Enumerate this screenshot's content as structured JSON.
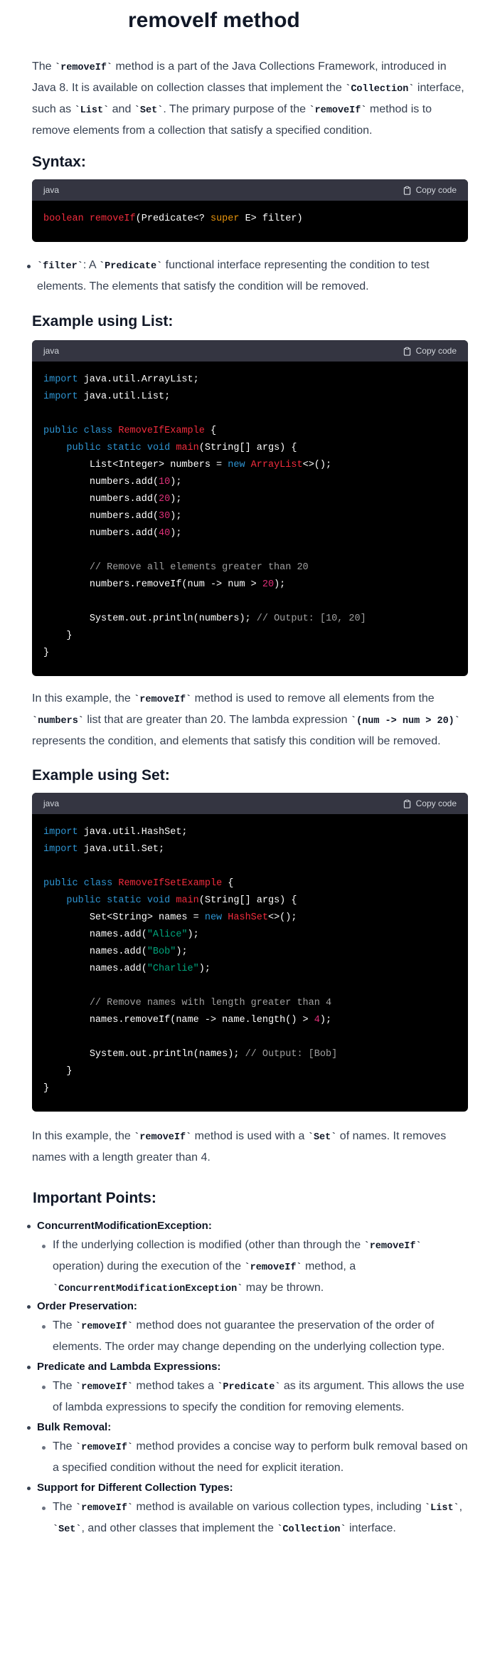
{
  "title": "removeIf method",
  "intro": {
    "t1": "The ",
    "c1": "`removeIf`",
    "t2": " method is a part of the Java Collections Framework, introduced in Java 8. It is available on collection classes that implement the ",
    "c2": "`Collection`",
    "t3": " interface, such as ",
    "c3": "`List`",
    "t4": " and ",
    "c4": "`Set`",
    "t5": ". The primary purpose of the ",
    "c5": "`removeIf`",
    "t6": " method is to remove elements from a collection that satisfy a specified condition."
  },
  "syntax_heading": "Syntax:",
  "code_lang": "java",
  "copy_label": "Copy code",
  "syntax_code": {
    "kw": "boolean",
    "fn": "removeIf",
    "a": "(Predicate<? ",
    "sup": "super",
    "b": " E> filter)"
  },
  "filter_item": {
    "c1": "`filter`",
    "t1": ": A ",
    "c2": "`Predicate`",
    "t2": " functional interface representing the condition to test elements. The elements that satisfy the condition will be removed."
  },
  "list_heading": "Example using List:",
  "list_code": {
    "l1a": "import",
    "l1b": " java.util.ArrayList;",
    "l2a": "import",
    "l2b": " java.util.List;",
    "l3a": "public",
    "l3b": "class",
    "l3c": "RemoveIfExample",
    "l3d": " {",
    "l4a": "public",
    "l4b": "static",
    "l4c": "void",
    "l4d": "main",
    "l4e": "(String[] args) {",
    "l5a": "List<Integer> numbers = ",
    "l5b": "new",
    "l5c": "ArrayList",
    "l5d": "<>();",
    "l6a": "numbers.add(",
    "l6b": "10",
    "l6c": ");",
    "l7a": "numbers.add(",
    "l7b": "20",
    "l7c": ");",
    "l8a": "numbers.add(",
    "l8b": "30",
    "l8c": ");",
    "l9a": "numbers.add(",
    "l9b": "40",
    "l9c": ");",
    "l10": "// Remove all elements greater than 20",
    "l11a": "numbers.removeIf(num -> num > ",
    "l11b": "20",
    "l11c": ");",
    "l12a": "System.out.println(numbers); ",
    "l12b": "// Output: [10, 20]",
    "l13": "}",
    "l14": "}"
  },
  "list_para": {
    "t1": "In this example, the ",
    "c1": "`removeIf`",
    "t2": " method is used to remove all elements from the ",
    "c2": "`numbers`",
    "t3": " list that are greater than 20. The lambda expression ",
    "c3": "`(num -> num > 20)`",
    "t4": " represents the condition, and elements that satisfy this condition will be removed."
  },
  "set_heading": "Example using Set:",
  "set_code": {
    "l1a": "import",
    "l1b": " java.util.HashSet;",
    "l2a": "import",
    "l2b": " java.util.Set;",
    "l3a": "public",
    "l3b": "class",
    "l3c": "RemoveIfSetExample",
    "l3d": " {",
    "l4a": "public",
    "l4b": "static",
    "l4c": "void",
    "l4d": "main",
    "l4e": "(String[] args) {",
    "l5a": "Set<String> names = ",
    "l5b": "new",
    "l5c": "HashSet",
    "l5d": "<>();",
    "l6a": "names.add(",
    "l6b": "\"Alice\"",
    "l6c": ");",
    "l7a": "names.add(",
    "l7b": "\"Bob\"",
    "l7c": ");",
    "l8a": "names.add(",
    "l8b": "\"Charlie\"",
    "l8c": ");",
    "l9": "// Remove names with length greater than 4",
    "l10a": "names.removeIf(name -> name.length() > ",
    "l10b": "4",
    "l10c": ");",
    "l11a": "System.out.println(names); ",
    "l11b": "// Output: [Bob]",
    "l12": "}",
    "l13": "}"
  },
  "set_para": {
    "t1": "In this example, the ",
    "c1": "`removeIf`",
    "t2": " method is used with a ",
    "c2": "`Set`",
    "t3": " of names. It removes names with a length greater than 4."
  },
  "points_heading": "Important Points:",
  "points": [
    {
      "label": "ConcurrentModificationException:",
      "t1": "If the underlying collection is modified (other than through the ",
      "c1": "`removeIf`",
      "t2": " operation) during the execution of the ",
      "c2": "`removeIf`",
      "t3": " method, a ",
      "c3": "`ConcurrentModificationException`",
      "t4": " may be thrown."
    },
    {
      "label": "Order Preservation:",
      "t1": "The ",
      "c1": "`removeIf`",
      "t2": " method does not guarantee the preservation of the order of elements. The order may change depending on the underlying collection type."
    },
    {
      "label": "Predicate and Lambda Expressions:",
      "t1": "The ",
      "c1": "`removeIf`",
      "t2": " method takes a ",
      "c2": "`Predicate`",
      "t3": " as its argument. This allows the use of lambda expressions to specify the condition for removing elements."
    },
    {
      "label": "Bulk Removal:",
      "t1": "The ",
      "c1": "`removeIf`",
      "t2": " method provides a concise way to perform bulk removal based on a specified condition without the need for explicit iteration."
    },
    {
      "label": "Support for Different Collection Types:",
      "t1": "The ",
      "c1": "`removeIf`",
      "t2": " method is available on various collection types, including ",
      "c2": "`List`",
      "t3": ", ",
      "c3": "`Set`",
      "t4": ", and other classes that implement the ",
      "c4": "`Collection`",
      "t5": " interface."
    }
  ]
}
